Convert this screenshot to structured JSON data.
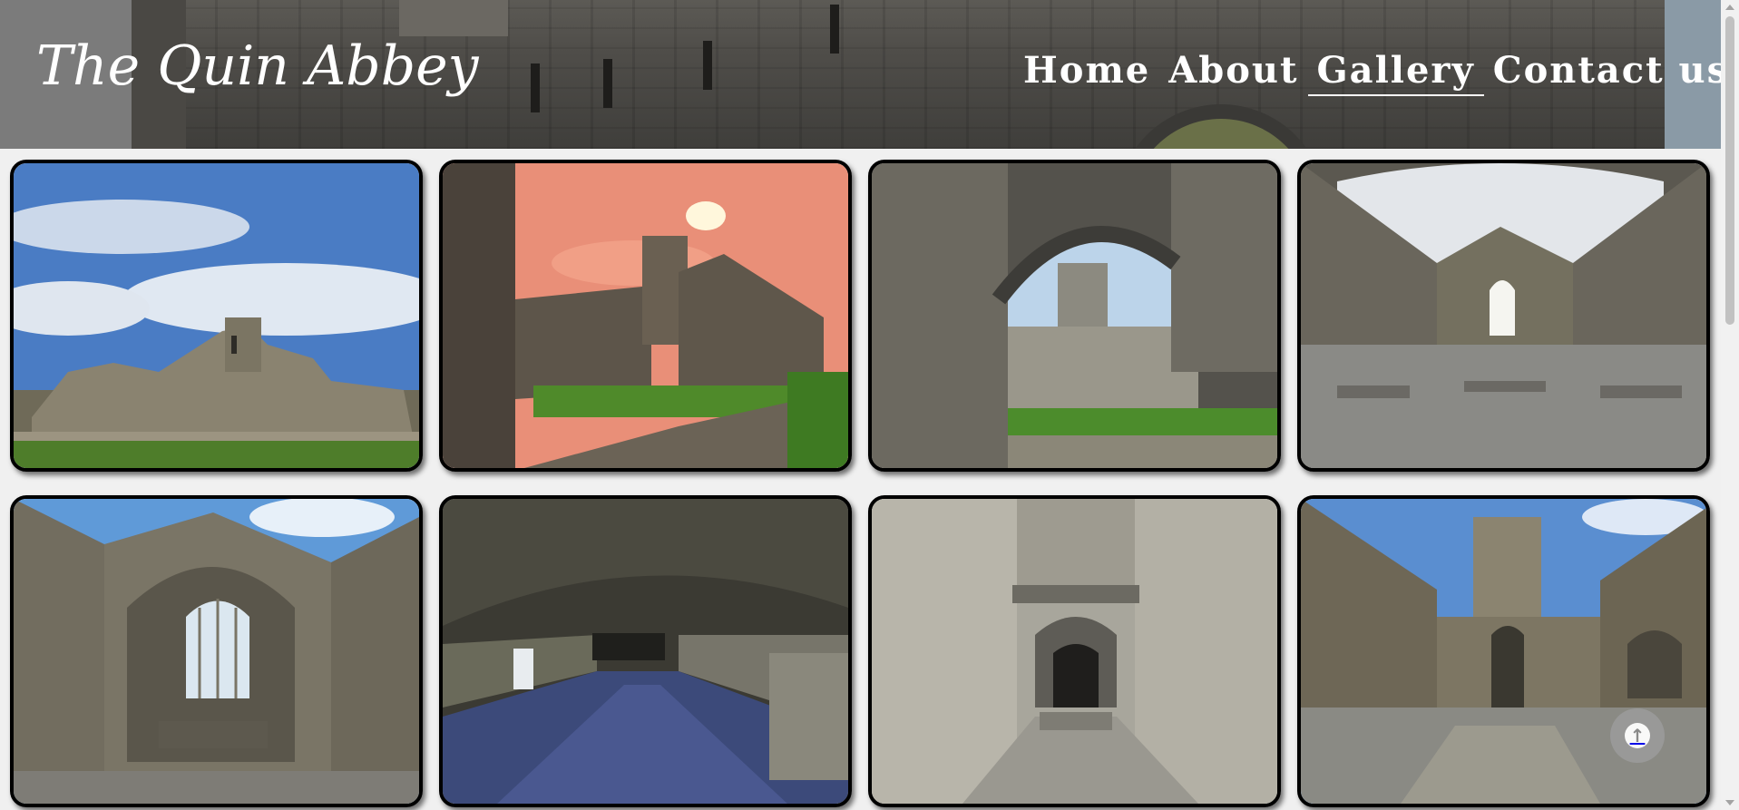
{
  "header": {
    "logo": "The Quin Abbey",
    "nav": [
      {
        "label": "Home",
        "active": false
      },
      {
        "label": "About",
        "active": false
      },
      {
        "label": "Gallery",
        "active": true
      },
      {
        "label": "Contact us",
        "active": false
      }
    ]
  },
  "gallery": {
    "photos": [
      {
        "subject": "abbey exterior under blue sky"
      },
      {
        "subject": "abbey ruins at sunset"
      },
      {
        "subject": "cloister seen through arch"
      },
      {
        "subject": "nave with gothic east window"
      },
      {
        "subject": "chancel with tracery window"
      },
      {
        "subject": "vaulted undercroft with gravel floor"
      },
      {
        "subject": "narrow stone passage"
      },
      {
        "subject": "nave looking toward tower"
      }
    ]
  },
  "back_to_top": {
    "icon": "arrow-up-circle-icon"
  },
  "colors": {
    "header_overlay": "#7b7b7b",
    "text": "#ffffff",
    "frame": "#000000",
    "background": "#f0f0f0"
  }
}
